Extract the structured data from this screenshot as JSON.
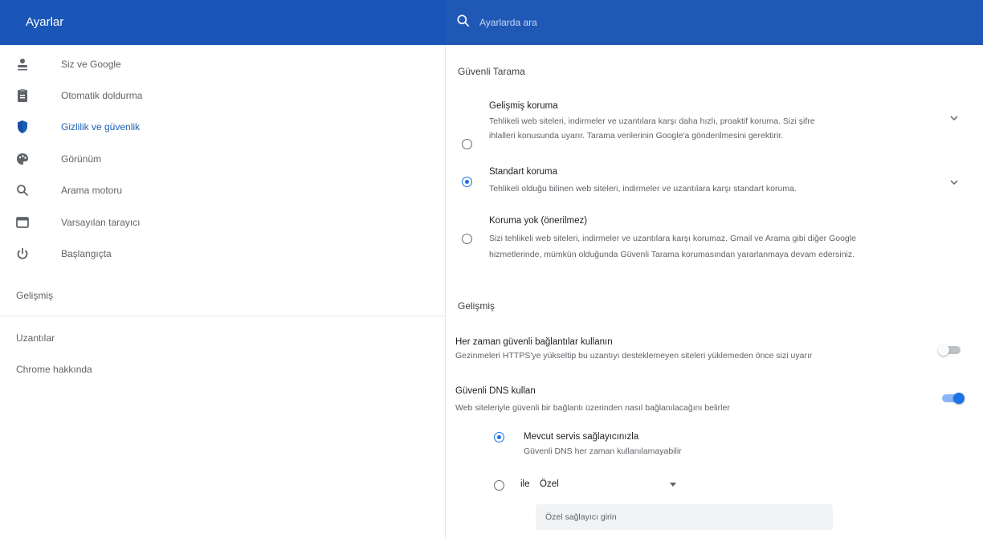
{
  "header": {
    "title": "Ayarlar",
    "search_placeholder": "Ayarlarda ara",
    "colors": {
      "bar": "#1a56b8",
      "accent": "#1a73e8"
    }
  },
  "sidebar": {
    "items": [
      {
        "label": "Siz ve Google",
        "icon": "person-icon"
      },
      {
        "label": "Otomatik doldurma",
        "icon": "clipboard-icon"
      },
      {
        "label": "Gizlilik ve güvenlik",
        "icon": "shield-icon",
        "active": true
      },
      {
        "label": "Görünüm",
        "icon": "palette-icon"
      },
      {
        "label": "Arama motoru",
        "icon": "search-icon"
      },
      {
        "label": "Varsayılan tarayıcı",
        "icon": "browser-icon"
      },
      {
        "label": "Başlangıçta",
        "icon": "power-icon"
      }
    ],
    "advanced": "Gelişmiş",
    "extensions": "Uzantılar",
    "about": "Chrome hakkında"
  },
  "main": {
    "safe_browsing_title": "Güvenli Tarama",
    "options": [
      {
        "title": "Gelişmiş koruma",
        "desc": [
          "Tehlikeli web siteleri, indirmeler ve uzantılara karşı daha hızlı, proaktif koruma. Sizi şifre",
          "ihlalleri konusunda uyarır. Tarama verilerinin Google'a gönderilmesini gerektirir."
        ],
        "selected": false
      },
      {
        "title": "Standart koruma",
        "desc": [
          "Tehlikeli olduğu bilinen web siteleri, indirmeler ve uzantılara karşı standart koruma."
        ],
        "selected": true
      },
      {
        "title": "Koruma yok (önerilmez)",
        "desc": [
          "Sizi tehlikeli web siteleri, indirmeler ve uzantılara karşı korumaz. Gmail ve Arama gibi diğer Google",
          "hizmetlerinde, mümkün olduğunda Güvenli Tarama korumasından yararlanmaya devam edersiniz."
        ],
        "selected": false
      }
    ],
    "advanced_title": "Gelişmiş",
    "https_only": {
      "title": "Her zaman güvenli bağlantılar kullanın",
      "desc": "Gezinmeleri HTTPS'ye yükseltip bu uzantıyı desteklemeyen siteleri yüklemeden önce sizi uyarır",
      "enabled": false
    },
    "secure_dns": {
      "title": "Güvenli DNS kullan",
      "desc": "Web siteleriyle güvenli bir bağlantı üzerinden nasıl bağlanılacağını belirler",
      "enabled": true,
      "current_provider": {
        "title": "Mevcut servis sağlayıcınızla",
        "desc": "Güvenli DNS her zaman kullanılamayabilir",
        "selected": true
      },
      "with_label": "ile",
      "custom_select_value": "Özel",
      "custom_input_placeholder": "Özel sağlayıcı girin"
    }
  }
}
